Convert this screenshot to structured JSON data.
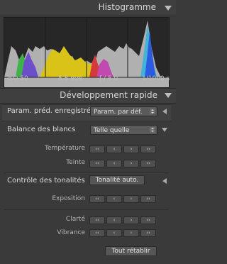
{
  "histogram": {
    "title": "Histogramme",
    "iso": "ISO 50",
    "focal": "5,8 mm",
    "aperture": "ƒ / 5,0",
    "shutter": "1/1000 s"
  },
  "dev": {
    "title": "Développement rapide",
    "preset_label": "Param. préd. enregistré",
    "preset_value": "Param. par déf.",
    "wb_label": "Balance des blancs",
    "wb_value": "Telle quelle",
    "temperature": "Température",
    "teinte": "Teinte",
    "tone_label": "Contrôle des tonalités",
    "auto_tone": "Tonalité auto.",
    "exposition": "Exposition",
    "clarte": "Clarté",
    "vibrance": "Vibrance",
    "reset": "Tout rétablir",
    "btn_fast_left": "‹‹",
    "btn_left": "‹",
    "btn_right": "›",
    "btn_fast_right": "››"
  }
}
